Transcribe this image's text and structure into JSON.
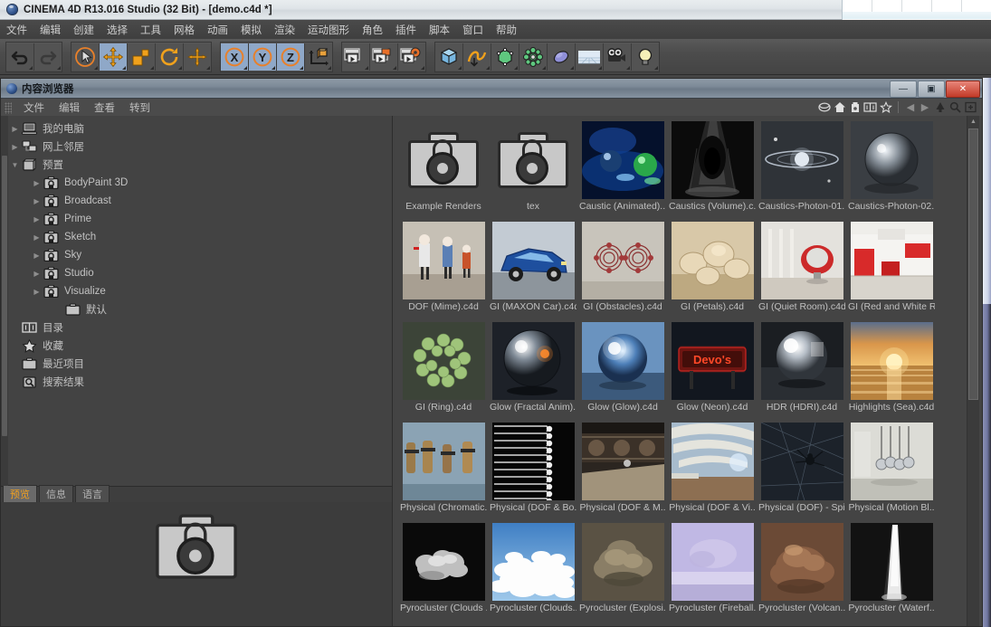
{
  "app": {
    "title": "CINEMA 4D R13.016 Studio (32 Bit) - [demo.c4d *]",
    "menu": [
      "文件",
      "编辑",
      "创建",
      "选择",
      "工具",
      "网格",
      "动画",
      "模拟",
      "渲染",
      "运动图形",
      "角色",
      "插件",
      "脚本",
      "窗口",
      "帮助"
    ]
  },
  "toolbar": {
    "groups": [
      {
        "name": "undo-redo",
        "buttons": [
          {
            "icon": "undo-icon",
            "label": "撤销",
            "selected": false
          },
          {
            "icon": "redo-icon",
            "label": "重做",
            "selected": false
          }
        ]
      },
      {
        "name": "transform",
        "buttons": [
          {
            "icon": "select-live-icon",
            "label": "实时选择",
            "selected": false
          },
          {
            "icon": "move-icon",
            "label": "移动",
            "selected": true
          },
          {
            "icon": "scale-icon",
            "label": "缩放",
            "selected": false
          },
          {
            "icon": "rotate-icon",
            "label": "旋转",
            "selected": false
          },
          {
            "icon": "add-icon",
            "label": "添加",
            "selected": false
          }
        ]
      },
      {
        "name": "axis-locks",
        "buttons": [
          {
            "icon": "axis-x-icon",
            "label": "X 轴",
            "selected": true
          },
          {
            "icon": "axis-y-icon",
            "label": "Y 轴",
            "selected": true
          },
          {
            "icon": "axis-z-icon",
            "label": "Z 轴",
            "selected": true
          },
          {
            "icon": "world-coord-icon",
            "label": "世界坐标",
            "selected": false
          }
        ]
      },
      {
        "name": "render",
        "buttons": [
          {
            "icon": "render-view-icon",
            "label": "渲染当前视图",
            "selected": false
          },
          {
            "icon": "render-region-icon",
            "label": "渲染到图像查看器",
            "selected": false
          },
          {
            "icon": "render-settings-icon",
            "label": "编辑渲染设置",
            "selected": false
          }
        ]
      },
      {
        "name": "objects",
        "buttons": [
          {
            "icon": "cube-icon",
            "label": "立方体",
            "selected": false
          },
          {
            "icon": "spline-icon",
            "label": "样条",
            "selected": false
          },
          {
            "icon": "nurbs-icon",
            "label": "生成器",
            "selected": false
          },
          {
            "icon": "deformer-icon",
            "label": "变形器",
            "selected": false
          },
          {
            "icon": "scene-icon",
            "label": "场景",
            "selected": false
          },
          {
            "icon": "floor-icon",
            "label": "地面",
            "selected": false
          },
          {
            "icon": "camera-icon",
            "label": "摄像机",
            "selected": false
          },
          {
            "icon": "light-icon",
            "label": "灯光",
            "selected": false
          }
        ]
      }
    ]
  },
  "content_browser": {
    "title": "内容浏览器",
    "window_buttons": {
      "minimize": "—",
      "maximize": "▣",
      "close": "✕"
    },
    "menu": [
      "文件",
      "编辑",
      "查看",
      "转到"
    ],
    "tools": [
      "globe-icon",
      "home-icon",
      "presets-icon",
      "catalog-icon",
      "favorites-icon"
    ],
    "nav": [
      "nav-back-icon",
      "nav-forward-icon",
      "up-icon",
      "search-icon",
      "new-folder-icon"
    ],
    "tree": [
      {
        "label": "我的电脑",
        "icon": "computer-icon",
        "indent": 1,
        "expanded": false,
        "has_arrow": true
      },
      {
        "label": "网上邻居",
        "icon": "network-icon",
        "indent": 1,
        "expanded": false,
        "has_arrow": true
      },
      {
        "label": "预置",
        "icon": "presets-icon",
        "indent": 1,
        "expanded": true,
        "has_arrow": true
      },
      {
        "label": "BodyPaint 3D",
        "icon": "lockbox-icon",
        "indent": 2,
        "expanded": false,
        "has_arrow": true
      },
      {
        "label": "Broadcast",
        "icon": "lockbox-icon",
        "indent": 2,
        "expanded": false,
        "has_arrow": true
      },
      {
        "label": "Prime",
        "icon": "lockbox-icon",
        "indent": 2,
        "expanded": false,
        "has_arrow": true
      },
      {
        "label": "Sketch",
        "icon": "lockbox-icon",
        "indent": 2,
        "expanded": false,
        "has_arrow": true
      },
      {
        "label": "Sky",
        "icon": "lockbox-icon",
        "indent": 2,
        "expanded": false,
        "has_arrow": true
      },
      {
        "label": "Studio",
        "icon": "lockbox-icon",
        "indent": 2,
        "expanded": false,
        "has_arrow": true
      },
      {
        "label": "Visualize",
        "icon": "lockbox-icon",
        "indent": 2,
        "expanded": false,
        "has_arrow": true
      },
      {
        "label": "默认",
        "icon": "folder-icon",
        "indent": 3,
        "expanded": false,
        "has_arrow": false
      },
      {
        "label": "目录",
        "icon": "catalog-icon",
        "indent": 1,
        "expanded": false,
        "has_arrow": false
      },
      {
        "label": "收藏",
        "icon": "star-icon",
        "indent": 1,
        "expanded": false,
        "has_arrow": false
      },
      {
        "label": "最近项目",
        "icon": "folder-icon",
        "indent": 1,
        "expanded": false,
        "has_arrow": false
      },
      {
        "label": "搜索结果",
        "icon": "search-folder-icon",
        "indent": 1,
        "expanded": false,
        "has_arrow": false
      }
    ],
    "preview_tabs": [
      {
        "label": "预览",
        "active": true
      },
      {
        "label": "信息",
        "active": false
      },
      {
        "label": "语言",
        "active": false
      }
    ],
    "items": [
      {
        "label": "Example Renders",
        "type": "folder"
      },
      {
        "label": "tex",
        "type": "folder"
      },
      {
        "label": "Caustic (Animated)...",
        "type": "image",
        "style": "caustic-anim"
      },
      {
        "label": "Caustics (Volume).c..",
        "type": "image",
        "style": "caustic-vol"
      },
      {
        "label": "Caustics-Photon-01..",
        "type": "image",
        "style": "photon01"
      },
      {
        "label": "Caustics-Photon-02..",
        "type": "image",
        "style": "photon02"
      },
      {
        "label": "DOF (Mime).c4d",
        "type": "image",
        "style": "mime"
      },
      {
        "label": "GI (MAXON Car).c4d",
        "type": "image",
        "style": "car"
      },
      {
        "label": "GI (Obstacles).c4d",
        "type": "image",
        "style": "obstacles"
      },
      {
        "label": "GI (Petals).c4d",
        "type": "image",
        "style": "petals"
      },
      {
        "label": "GI (Quiet Room).c4d",
        "type": "image",
        "style": "quietroom"
      },
      {
        "label": "GI (Red and White R..",
        "type": "image",
        "style": "redwhite"
      },
      {
        "label": "GI (Ring).c4d",
        "type": "image",
        "style": "ring"
      },
      {
        "label": "Glow (Fractal Anim)..",
        "type": "image",
        "style": "fractal"
      },
      {
        "label": "Glow (Glow).c4d",
        "type": "image",
        "style": "glow"
      },
      {
        "label": "Glow (Neon).c4d",
        "type": "image",
        "style": "neon"
      },
      {
        "label": "HDR (HDRI).c4d",
        "type": "image",
        "style": "hdri"
      },
      {
        "label": "Highlights (Sea).c4d",
        "type": "image",
        "style": "sea"
      },
      {
        "label": "Physical (Chromatic..",
        "type": "image",
        "style": "chromatic"
      },
      {
        "label": "Physical (DOF & Bo..",
        "type": "image",
        "style": "dofbokeh"
      },
      {
        "label": "Physical (DOF & M..",
        "type": "image",
        "style": "dofm"
      },
      {
        "label": "Physical (DOF & Vi..",
        "type": "image",
        "style": "dofvi"
      },
      {
        "label": "Physical (DOF) - Spi..",
        "type": "image",
        "style": "spider"
      },
      {
        "label": "Physical (Motion Bl..",
        "type": "image",
        "style": "motionblur"
      },
      {
        "label": "Pyrocluster (Clouds ..",
        "type": "image",
        "style": "clouds1"
      },
      {
        "label": "Pyrocluster (Clouds..",
        "type": "image",
        "style": "clouds2"
      },
      {
        "label": "Pyrocluster (Explosi..",
        "type": "image",
        "style": "explosion"
      },
      {
        "label": "Pyrocluster (Fireball..",
        "type": "image",
        "style": "fireball"
      },
      {
        "label": "Pyrocluster (Volcan..",
        "type": "image",
        "style": "volcano"
      },
      {
        "label": "Pyrocluster (Waterf..",
        "type": "image",
        "style": "waterfall"
      }
    ]
  },
  "colors": {
    "accent": "#f0a020",
    "selection": "#8fa8c8",
    "window_chrome": "#7d8a98",
    "panel_bg": "#434343",
    "close_button": "#c33a28"
  }
}
